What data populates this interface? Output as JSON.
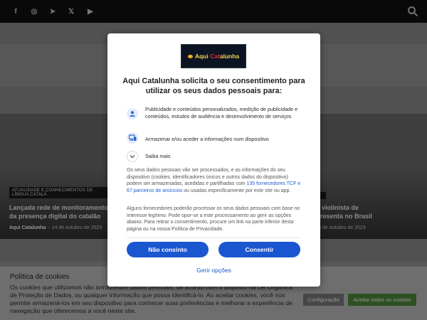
{
  "topbar": {
    "social_icons": [
      {
        "name": "facebook-icon",
        "glyph": "f"
      },
      {
        "name": "instagram-icon",
        "glyph": "◎"
      },
      {
        "name": "telegram-icon",
        "glyph": "➤"
      },
      {
        "name": "x-icon",
        "glyph": "𝕏"
      },
      {
        "name": "youtube-icon",
        "glyph": "▶"
      }
    ],
    "search_icon": "search-icon"
  },
  "articles": {
    "left": {
      "category": "ATUALIDADE E CONHECIMENTOS DE LÍNGUA CATALÃ",
      "title": "Lançada rede de monitoramento da presença digital do catalão",
      "author": "Aqui Catalunha",
      "date": "14 de outubro de 2023"
    },
    "right": {
      "title_line1": "rrallet, violinista de",
      "title_line2": ", se apresenta no Brasil",
      "author": "unha",
      "date": "8 de outubro de 2023"
    }
  },
  "cookie_bar": {
    "title": "Política de cookies",
    "text": "Os cookies que utilizamos não armazenam dados pessoais, de acordo com o disposto na Lei Orgânica de Proteção de Dados, ou qualquer informação que possa identificá-lo. Ao aceitar cookies, você nos permite armazená-los em seu dispositivo para conhecer suas preferências e melhorar a experiência de navegação que oferecemos a você neste site.",
    "config_label": "Configuração",
    "accept_label": "Aceitar todos os cookies"
  },
  "dialog": {
    "logo": {
      "part1": "Aqui ",
      "part2": "Cat",
      "part3": "alunha"
    },
    "title": "Aqui Catalunha solicita o seu consentimento para utilizar os seus dados pessoais para:",
    "purposes": [
      {
        "icon": "person-icon",
        "text": "Publicidade e conteúdos personalizados, medição de publicidade e conteúdos, estudos de audiência e desenvolvimento de serviços"
      },
      {
        "icon": "device-icon",
        "text": "Armazenar e/ou aceder a informações num dispositivo"
      }
    ],
    "more_label": "Saiba mais",
    "body1_pre": "Os seus dados pessoais vão ser processados, e as informações do seu dispositivo (cookies, identificadores únicos e outros dados do dispositivo) podem ser armazenadas, acedidas e partilhadas com ",
    "body1_link": "135 fornecedores TCF e 67 parceiros de anúncios",
    "body1_post": " ou usadas especificamente por este site ou app.",
    "body2": "Alguns fornecedores poderão processar os seus dados pessoais com base no interesse legítimo. Pode opor-se a este processamento ao gerir as opções abaixo. Para retirar o consentimento, procure um link na parte inferior desta página ou na nossa Política de Privacidade.",
    "deny_label": "Não consinto",
    "accept_label": "Consentir",
    "manage_label": "Gerir opções"
  },
  "colors": {
    "primary_blue": "#1a56d0",
    "cookie_accept_green": "#4f8a3a",
    "topbar": "#111111"
  }
}
